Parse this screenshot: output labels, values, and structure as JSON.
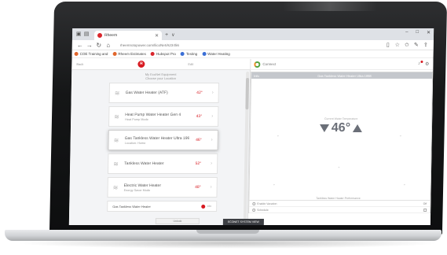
{
  "browser": {
    "tab_title": "Rheem",
    "new_tab": "+",
    "tab_chevron": "∨",
    "url": "rheemrotopower.com/EcoNet/A23456",
    "window_controls": [
      "–",
      "□",
      "✕"
    ],
    "bookmarks": [
      {
        "label": "COE Training and",
        "color": "#e0662c"
      },
      {
        "label": "Rheem Estimates",
        "color": "#e0662c"
      },
      {
        "label": "Hubspot Pro",
        "color": "#d9262c"
      },
      {
        "label": "Testing",
        "color": "#3b6fd6"
      },
      {
        "label": "Water Heating",
        "color": "#3b6fd6"
      }
    ]
  },
  "app": {
    "left_link": "Back",
    "right_link": "Edit",
    "subtitle_1": "My EcoNet Equipment",
    "subtitle_2": "Choose your Location",
    "equipment": [
      {
        "name": "Gas Water Heater (ATF)",
        "sub": "",
        "temp": "42°"
      },
      {
        "name": "Heat Pump Water Heater Gen 4",
        "sub": "Heat Pump Mode",
        "temp": "43°"
      },
      {
        "name": "Gas Tankless Water Heater Ultra 1998",
        "sub": "Location: Home",
        "temp": "46°"
      },
      {
        "name": "Tankless Water Heater",
        "sub": "",
        "temp": "52°"
      },
      {
        "name": "Electric Water Heater",
        "sub": "Energy Saver Mode",
        "temp": "48°"
      }
    ],
    "last_item": "Gas Tankless Water Heater",
    "last_status": "Idle",
    "brand": "Connect",
    "panel_left": "Info",
    "panel_title": "Gas Tankless Water Heater Ultra 1998",
    "setpoint_label": "Current Water Temperature",
    "setpoint": "46°",
    "mode_label": "Tankless Water Heater Performance",
    "footer_row_1": "Enable Vacation",
    "footer_row_1_right": "Off",
    "footer_row_2": "Schedule",
    "bottom_bar": "Unlock",
    "bottom_tab": "ECONET SYSTEM VIEW"
  }
}
